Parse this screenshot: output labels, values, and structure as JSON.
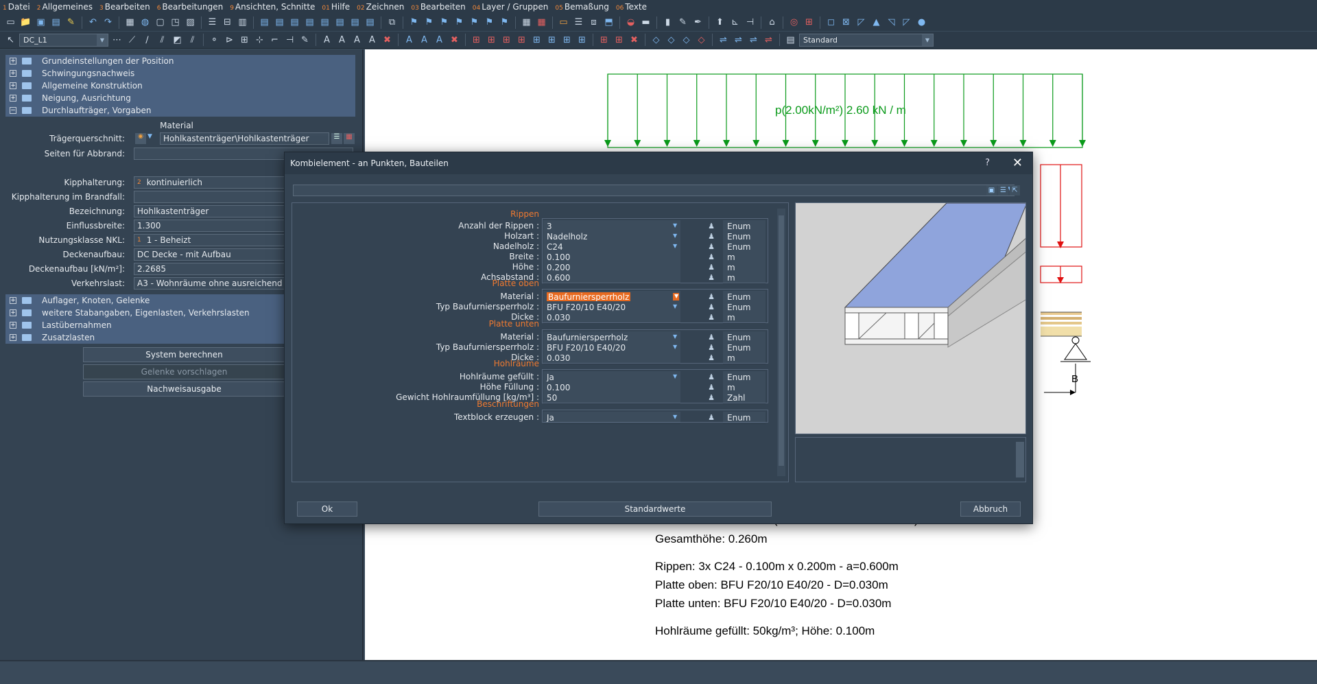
{
  "menu": [
    {
      "num": "1",
      "label": "Datei"
    },
    {
      "num": "2",
      "label": "Allgemeines"
    },
    {
      "num": "3",
      "label": "Bearbeiten"
    },
    {
      "num": "6",
      "label": "Bearbeitungen"
    },
    {
      "num": "9",
      "label": "Ansichten, Schnitte"
    },
    {
      "num": "01",
      "label": "Hilfe"
    },
    {
      "num": "02",
      "label": "Zeichnen"
    },
    {
      "num": "03",
      "label": "Bearbeiten"
    },
    {
      "num": "04",
      "label": "Layer / Gruppen"
    },
    {
      "num": "05",
      "label": "Bemaßung"
    },
    {
      "num": "06",
      "label": "Texte"
    }
  ],
  "toolbar": {
    "layer_combo": "DC_L1",
    "style_combo": "Standard"
  },
  "tree_top": [
    {
      "sign": "+",
      "label": "Grundeinstellungen der Position"
    },
    {
      "sign": "+",
      "label": "Schwingungsnachweis"
    },
    {
      "sign": "+",
      "label": "Allgemeine Konstruktion"
    },
    {
      "sign": "+",
      "label": "Neigung, Ausrichtung"
    },
    {
      "sign": "−",
      "label": "Durchlaufträger, Vorgaben"
    }
  ],
  "props": {
    "header": "Material",
    "traeger_label": "Trägerquerschnitt:",
    "traeger_value": "Hohlkastenträger\\Hohlkastenträger",
    "seiten_label": "Seiten für Abbrand:",
    "seiten_value": "",
    "kipp_label": "Kipphalterung:",
    "kipp_idx": "2",
    "kipp_value": "kontinuierlich",
    "kippbrand_label": "Kipphalterung im Brandfall:",
    "kippbrand_value": "",
    "bez_label": "Bezeichnung:",
    "bez_value": "Hohlkastenträger",
    "einfl_label": "Einflussbreite:",
    "einfl_value": "1.300",
    "nkl_label": "Nutzungsklasse NKL:",
    "nkl_idx": "1",
    "nkl_value": "1 - Beheizt",
    "decke_label": "Deckenaufbau:",
    "decke_value": "DC Decke - mit Aufbau",
    "deckekn_label": "Deckenaufbau [kN/m²]:",
    "deckekn_value": "2.2685",
    "verkehr_label": "Verkehrslast:",
    "verkehr_value": "A3 - Wohnräume ohne ausreichend"
  },
  "tree_bottom": [
    {
      "sign": "+",
      "label": "Auflager, Knoten, Gelenke"
    },
    {
      "sign": "+",
      "label": "weitere Stabangaben, Eigenlasten, Verkehrslasten"
    },
    {
      "sign": "+",
      "label": "Lastübernahmen"
    },
    {
      "sign": "+",
      "label": "Zusatzlasten"
    }
  ],
  "left_buttons": {
    "system": "System berechnen",
    "gelenke": "Gelenke vorschlagen",
    "nachweis": "Nachweisausgabe"
  },
  "drawing": {
    "load_label": "p(2.00kN/m²) 2.60 kN / m",
    "support_label": "B",
    "partial_line": "Gesamtbreite: 1.300m (Einflussbreite kontrollieren)",
    "gesamthoehe": "Gesamthöhe: 0.260m",
    "rippen": "Rippen: 3x C24 - 0.100m x 0.200m - a=0.600m",
    "platte_oben": "Platte oben: BFU F20/10 E40/20 - D=0.030m",
    "platte_unten": "Platte unten: BFU F20/10 E40/20 - D=0.030m",
    "hohlraeume": "Hohlräume gefüllt: 50kg/m³; Höhe: 0.100m"
  },
  "dialog": {
    "title": "Kombielement - an Punkten, Bauteilen",
    "help": "?",
    "close": "✕",
    "sections": {
      "rippen": "Rippen",
      "platte_oben": "Platte oben",
      "platte_unten": "Platte unten",
      "hohlraeume": "Hohlräume",
      "beschriftungen": "Beschriftungen"
    },
    "fields": [
      {
        "label": "Anzahl der Rippen :",
        "value": "3",
        "unit": "Enum",
        "dd": true
      },
      {
        "label": "Holzart :",
        "value": "Nadelholz",
        "unit": "Enum",
        "dd": true
      },
      {
        "label": "Nadelholz :",
        "value": "C24",
        "unit": "Enum",
        "dd": true
      },
      {
        "label": "Breite :",
        "value": "0.100",
        "unit": "m",
        "dd": false
      },
      {
        "label": "Höhe :",
        "value": "0.200",
        "unit": "m",
        "dd": false
      },
      {
        "label": "Achsabstand :",
        "value": "0.600",
        "unit": "m",
        "dd": false
      },
      {
        "label": "Material :",
        "value": "Baufurniersperrholz",
        "unit": "Enum",
        "dd": true
      },
      {
        "label": "Typ Baufurniersperrholz :",
        "value": "BFU F20/10 E40/20",
        "unit": "Enum",
        "dd": true
      },
      {
        "label": "Dicke :",
        "value": "0.030",
        "unit": "m",
        "dd": false
      },
      {
        "label": "Material :",
        "value": "Baufurniersperrholz",
        "unit": "Enum",
        "dd": true
      },
      {
        "label": "Typ Baufurniersperrholz :",
        "value": "BFU F20/10 E40/20",
        "unit": "Enum",
        "dd": true
      },
      {
        "label": "Dicke :",
        "value": "0.030",
        "unit": "m",
        "dd": false
      },
      {
        "label": "Hohlräume gefüllt :",
        "value": "Ja",
        "unit": "Enum",
        "dd": true
      },
      {
        "label": "Höhe Füllung :",
        "value": "0.100",
        "unit": "m",
        "dd": false
      },
      {
        "label": "Gewicht Hohlraumfüllung [kg/m³] :",
        "value": "50",
        "unit": "Zahl",
        "dd": false
      },
      {
        "label": "Textblock erzeugen :",
        "value": "Ja",
        "unit": "Enum",
        "dd": true
      }
    ],
    "buttons": {
      "ok": "Ok",
      "standard": "Standardwerte",
      "cancel": "Abbruch"
    }
  },
  "colors": {
    "accent_orange": "#f07a30",
    "load_green": "#0a9a1a",
    "load_red": "#e01010",
    "top_plate": "#8fa4dc"
  }
}
